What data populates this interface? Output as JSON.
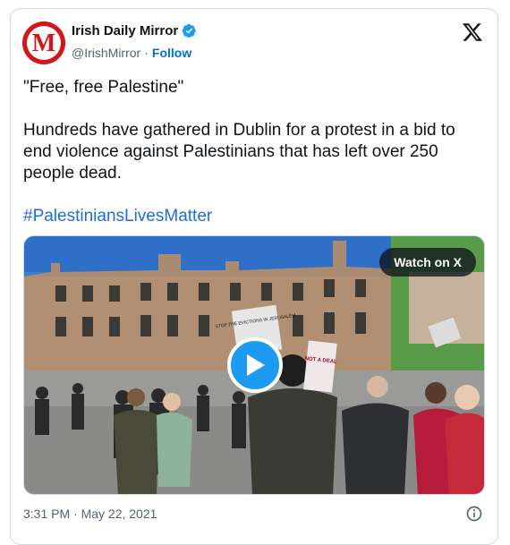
{
  "account": {
    "name": "Irish Daily Mirror",
    "handle": "@IrishMirror",
    "separator": "·",
    "follow_label": "Follow",
    "avatar_letter": "M"
  },
  "tweet": {
    "quote": "\"Free, free Palestine\"",
    "body": "Hundreds have gathered in Dublin for a protest in a bid to end violence against Palestinians that has left over 250 people dead.",
    "hashtag": "#PalestiniansLivesMatter"
  },
  "media": {
    "watch_label": "Watch on X",
    "sign_text": "STOP THE EVICTIONS IN JERUSALEM",
    "sign_text_2": "NOT A DEAL"
  },
  "footer": {
    "timestamp": "3:31 PM · May 22, 2021"
  },
  "icons": {
    "verified": "verified-badge-icon",
    "x_logo": "x-logo-icon",
    "play": "play-icon",
    "info": "info-icon"
  },
  "colors": {
    "brand_red": "#d7141a",
    "link_blue": "#1d6fd6",
    "play_blue": "#1d9bf0"
  }
}
